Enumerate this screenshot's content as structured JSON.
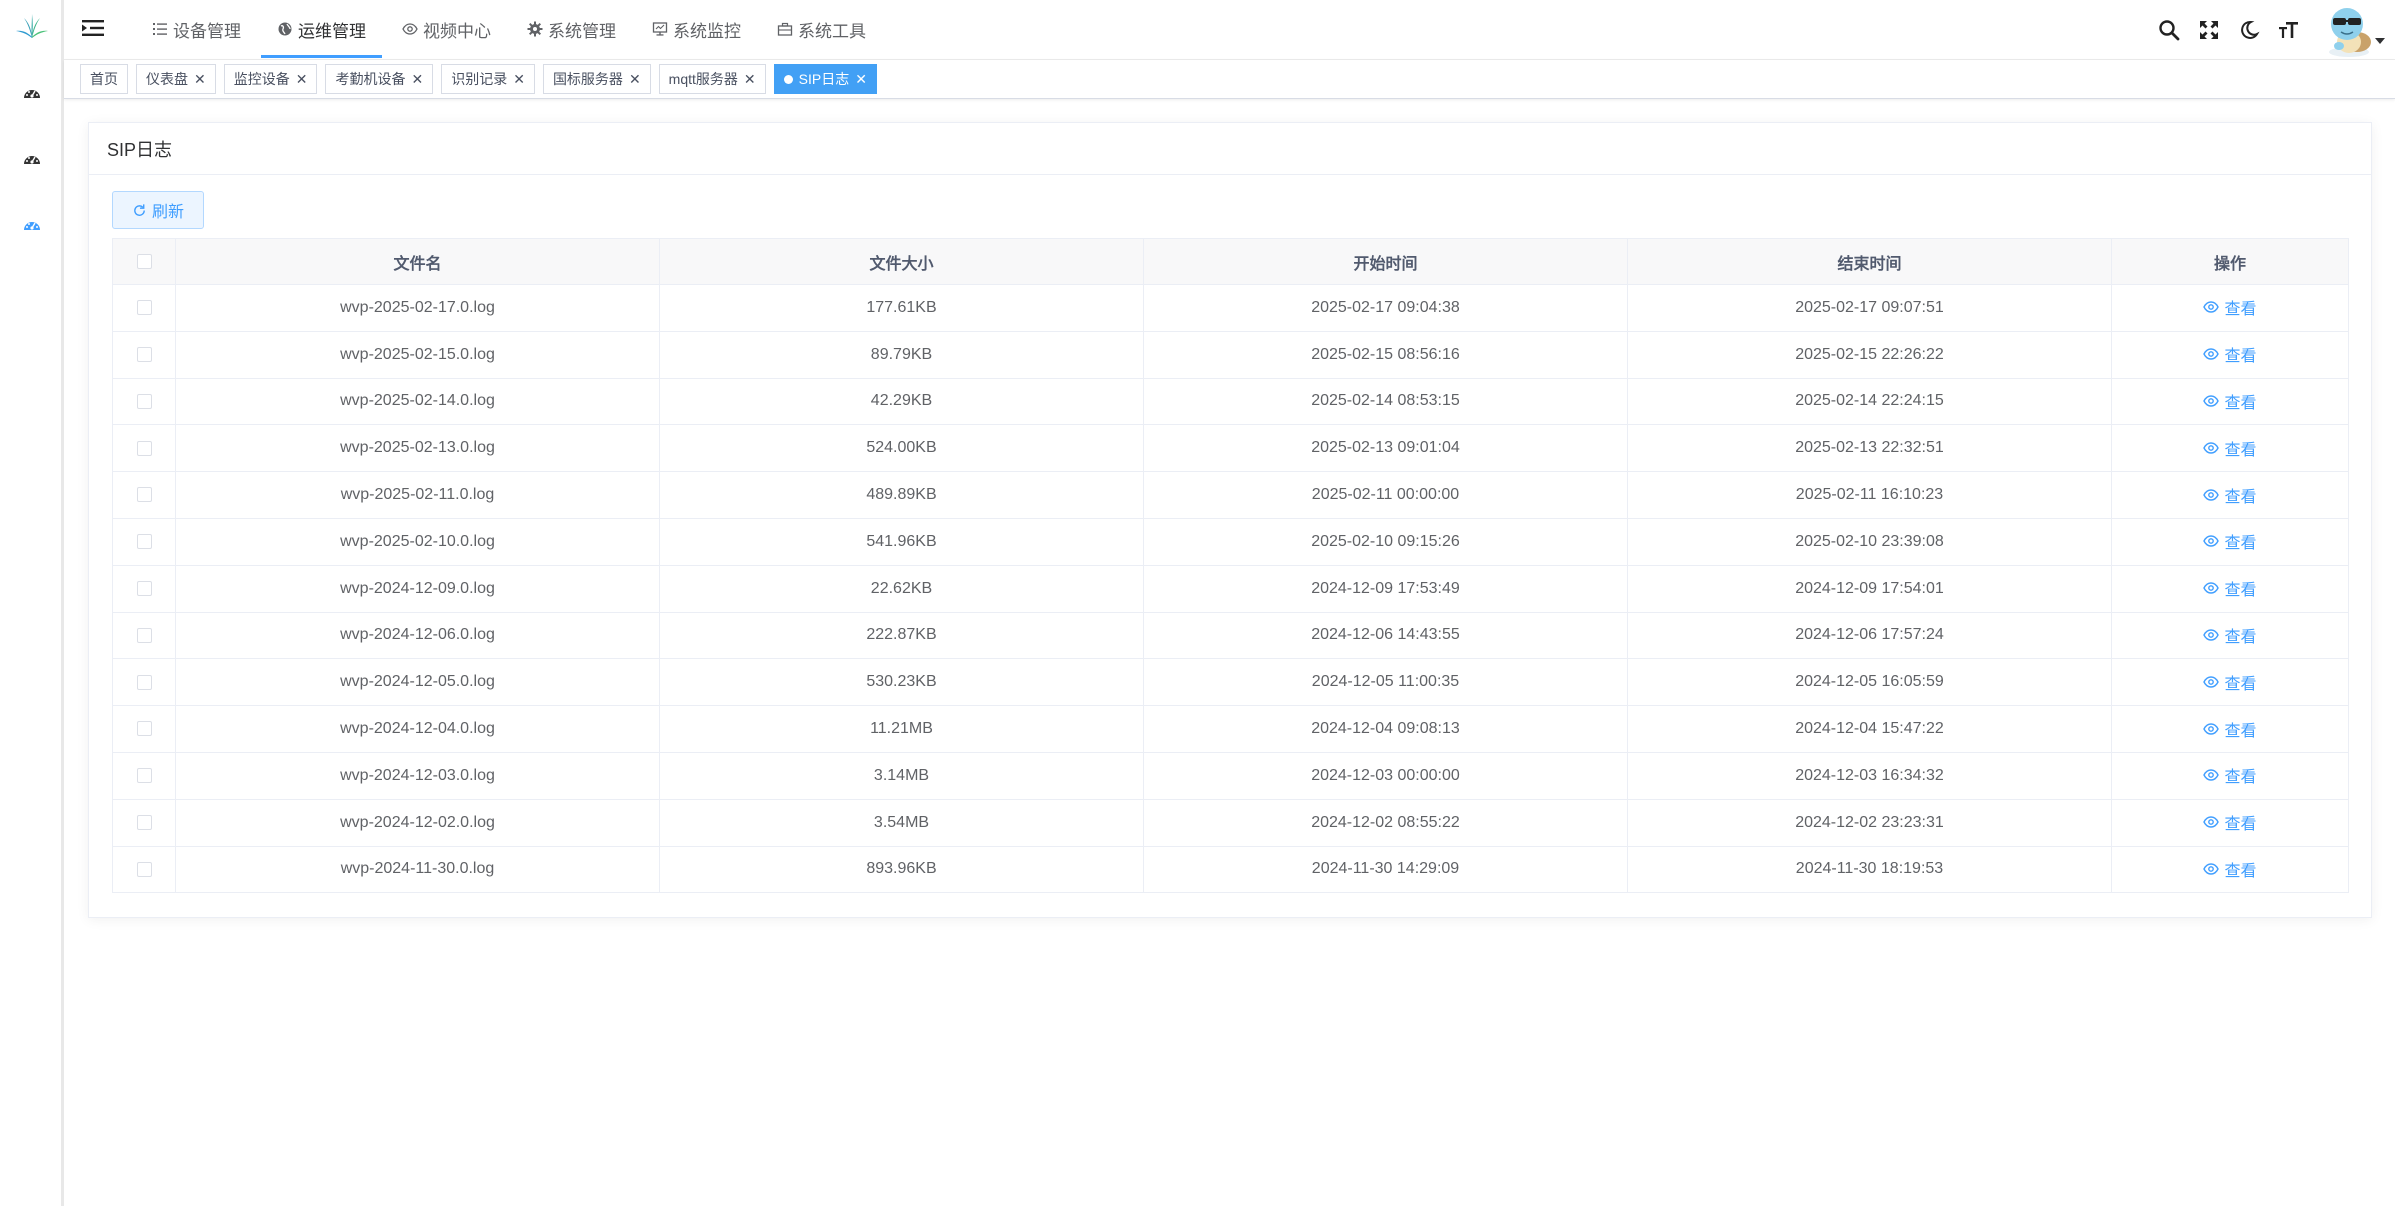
{
  "nav": {
    "menu": [
      {
        "label": "设备管理",
        "icon": "list-icon"
      },
      {
        "label": "运维管理",
        "icon": "globe-icon",
        "active": true
      },
      {
        "label": "视频中心",
        "icon": "eye-icon"
      },
      {
        "label": "系统管理",
        "icon": "gear-icon"
      },
      {
        "label": "系统监控",
        "icon": "monitor-icon"
      },
      {
        "label": "系统工具",
        "icon": "toolbox-icon"
      }
    ]
  },
  "tags": [
    {
      "label": "首页",
      "closable": false
    },
    {
      "label": "仪表盘",
      "closable": true
    },
    {
      "label": "监控设备",
      "closable": true
    },
    {
      "label": "考勤机设备",
      "closable": true
    },
    {
      "label": "识别记录",
      "closable": true
    },
    {
      "label": "国标服务器",
      "closable": true
    },
    {
      "label": "mqtt服务器",
      "closable": true
    },
    {
      "label": "SIP日志",
      "closable": true,
      "active": true
    }
  ],
  "card": {
    "title": "SIP日志",
    "refresh_label": "刷新"
  },
  "table": {
    "headers": {
      "name": "文件名",
      "size": "文件大小",
      "start": "开始时间",
      "end": "结束时间",
      "action": "操作"
    },
    "action_label": "查看",
    "rows": [
      {
        "name": "wvp-2025-02-17.0.log",
        "size": "177.61KB",
        "start": "2025-02-17 09:04:38",
        "end": "2025-02-17 09:07:51"
      },
      {
        "name": "wvp-2025-02-15.0.log",
        "size": "89.79KB",
        "start": "2025-02-15 08:56:16",
        "end": "2025-02-15 22:26:22"
      },
      {
        "name": "wvp-2025-02-14.0.log",
        "size": "42.29KB",
        "start": "2025-02-14 08:53:15",
        "end": "2025-02-14 22:24:15"
      },
      {
        "name": "wvp-2025-02-13.0.log",
        "size": "524.00KB",
        "start": "2025-02-13 09:01:04",
        "end": "2025-02-13 22:32:51"
      },
      {
        "name": "wvp-2025-02-11.0.log",
        "size": "489.89KB",
        "start": "2025-02-11 00:00:00",
        "end": "2025-02-11 16:10:23"
      },
      {
        "name": "wvp-2025-02-10.0.log",
        "size": "541.96KB",
        "start": "2025-02-10 09:15:26",
        "end": "2025-02-10 23:39:08"
      },
      {
        "name": "wvp-2024-12-09.0.log",
        "size": "22.62KB",
        "start": "2024-12-09 17:53:49",
        "end": "2024-12-09 17:54:01"
      },
      {
        "name": "wvp-2024-12-06.0.log",
        "size": "222.87KB",
        "start": "2024-12-06 14:43:55",
        "end": "2024-12-06 17:57:24"
      },
      {
        "name": "wvp-2024-12-05.0.log",
        "size": "530.23KB",
        "start": "2024-12-05 11:00:35",
        "end": "2024-12-05 16:05:59"
      },
      {
        "name": "wvp-2024-12-04.0.log",
        "size": "11.21MB",
        "start": "2024-12-04 09:08:13",
        "end": "2024-12-04 15:47:22"
      },
      {
        "name": "wvp-2024-12-03.0.log",
        "size": "3.14MB",
        "start": "2024-12-03 00:00:00",
        "end": "2024-12-03 16:34:32"
      },
      {
        "name": "wvp-2024-12-02.0.log",
        "size": "3.54MB",
        "start": "2024-12-02 08:55:22",
        "end": "2024-12-02 23:23:31"
      },
      {
        "name": "wvp-2024-11-30.0.log",
        "size": "893.96KB",
        "start": "2024-11-30 14:29:09",
        "end": "2024-11-30 18:19:53"
      }
    ]
  },
  "colors": {
    "accent": "#409eff",
    "active_tag": "#42a0f5"
  }
}
